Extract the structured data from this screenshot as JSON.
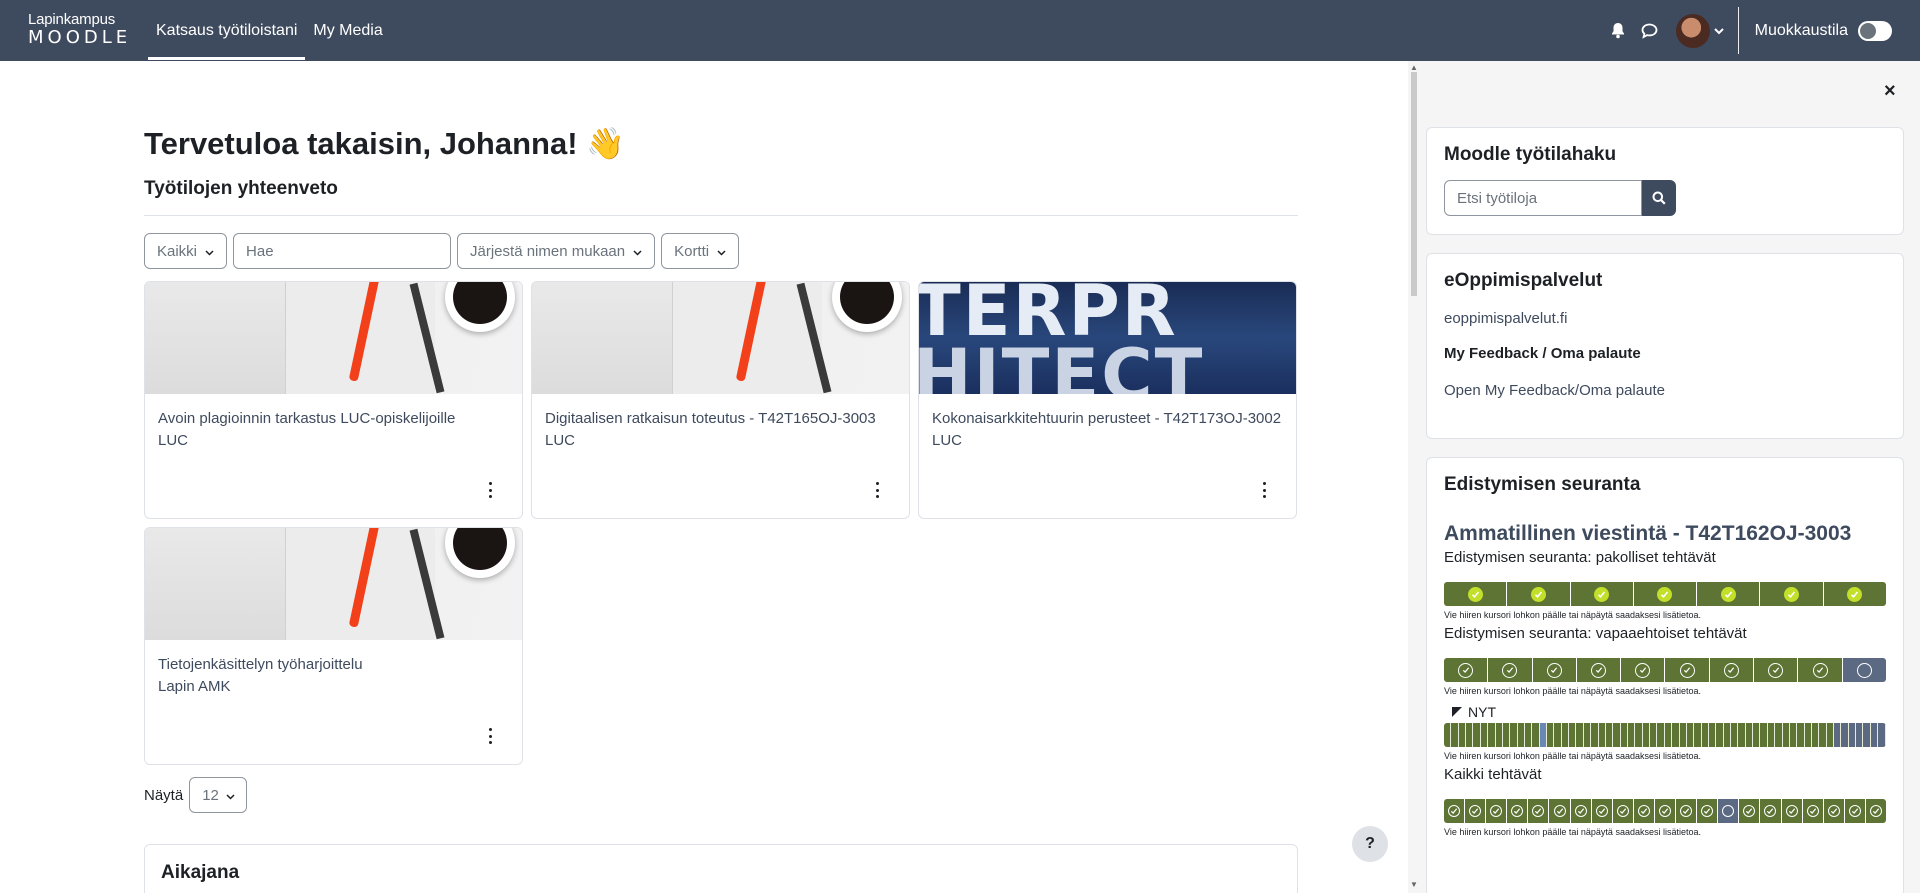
{
  "brand": {
    "line1": "Lapinkampus",
    "line2": "MOODLE"
  },
  "nav": {
    "links": [
      {
        "label": "Katsaus työtiloistani",
        "active": true
      },
      {
        "label": "My Media",
        "active": false
      }
    ],
    "icons": [
      "bell-icon",
      "chat-icon"
    ],
    "edit_mode_label": "Muokkaustila",
    "edit_mode_on": false
  },
  "main": {
    "welcome": "Tervetuloa takaisin, Johanna! 👋",
    "subtitle": "Työtilojen yhteenveto",
    "filters": {
      "grouping": "Kaikki",
      "search_placeholder": "Hae",
      "sort": "Järjestä nimen mukaan",
      "view": "Kortti"
    },
    "courses": [
      {
        "title": "Avoin plagioinnin tarkastus LUC-opiskelijoille",
        "category": "LUC",
        "image": "desk-pen-coffee"
      },
      {
        "title": "Digitaalisen ratkaisun toteutus - T42T165OJ-3003",
        "category": "LUC",
        "image": "desk-pen-coffee"
      },
      {
        "title": "Kokonaisarkkitehtuurin perusteet - T42T173OJ-3002",
        "category": "LUC",
        "image": "enterprise-architecture",
        "image_text_1": "TERPR",
        "image_text_2": "HITECT"
      },
      {
        "title": "Tietojenkäsittelyn työharjoittelu",
        "category": "Lapin AMK",
        "image": "desk-pen-coffee"
      }
    ],
    "show_label": "Näytä",
    "show_count": "12",
    "timeline_title": "Aikajana",
    "help": "?"
  },
  "drawer": {
    "close": "×",
    "search_block": {
      "title": "Moodle työtilahaku",
      "placeholder": "Etsi työtiloja"
    },
    "eoppimis_block": {
      "title": "eOppimispalvelut",
      "link": "eoppimispalvelut.fi",
      "feedback_heading": "My Feedback / Oma palaute",
      "feedback_link": "Open My Feedback/Oma palaute"
    },
    "progress_block": {
      "title": "Edistymisen seuranta",
      "course": "Ammatillinen viestintä - T42T162OJ-3003",
      "mandatory_label": "Edistymisen seuranta: pakolliset tehtävät",
      "mandatory_states": [
        "done",
        "done",
        "done",
        "done",
        "done",
        "done",
        "done"
      ],
      "optional_label": "Edistymisen seuranta: vapaaehtoiset tehtävät",
      "optional_states": [
        "done",
        "done",
        "done",
        "done",
        "done",
        "done",
        "done",
        "done",
        "done",
        "todo"
      ],
      "hint": "Vie hiiren kursori lohkon päälle tai näpäytä saadaksesi lisätietoa.",
      "now_label": "NYT",
      "all_label": "Kaikki tehtävät",
      "all_states": [
        "done",
        "done",
        "done",
        "done",
        "done",
        "done",
        "done",
        "done",
        "done",
        "done",
        "done",
        "done",
        "done",
        "todo",
        "done",
        "done",
        "done",
        "done",
        "done",
        "done",
        "done"
      ]
    }
  },
  "colors": {
    "navbar": "#3e4a5d",
    "progress_done": "#5d7434",
    "progress_todo": "#5b6a82",
    "check_fill": "#c2df2a"
  }
}
